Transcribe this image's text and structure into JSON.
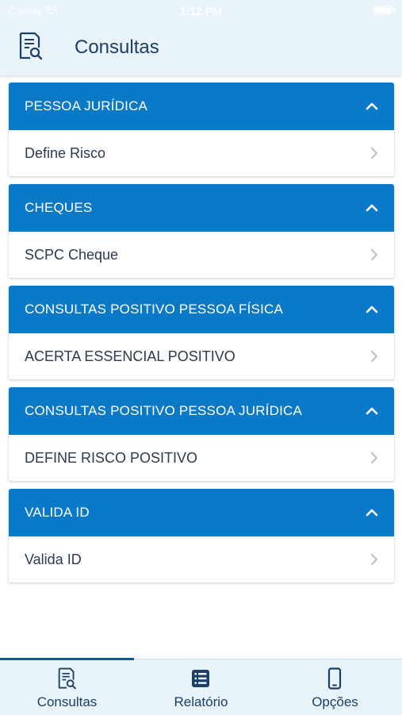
{
  "status_bar": {
    "carrier": "Carrier",
    "time": "1:12 PM"
  },
  "header": {
    "title": "Consultas",
    "icon": "document-search-icon"
  },
  "sections": [
    {
      "title": "PESSOA JURÍDICA",
      "item": "Define Risco"
    },
    {
      "title": "CHEQUES",
      "item": "SCPC Cheque"
    },
    {
      "title": "CONSULTAS POSITIVO PESSOA FÍSICA",
      "item": "ACERTA ESSENCIAL POSITIVO"
    },
    {
      "title": "CONSULTAS POSITIVO PESSOA JURÍDICA",
      "item": "DEFINE RISCO POSITIVO"
    },
    {
      "title": "VALIDA ID",
      "item": "Valida ID"
    }
  ],
  "tabs": [
    {
      "label": "Consultas",
      "icon": "document-search-icon",
      "active": true
    },
    {
      "label": "Relatório",
      "icon": "list-icon",
      "active": false
    },
    {
      "label": "Opções",
      "icon": "phone-icon",
      "active": false
    }
  ],
  "colors": {
    "accent": "#0a7ac8",
    "header_bg": "#e9f3fa",
    "title_text": "#1d3e66",
    "item_text": "#2b3a4c",
    "chevron": "#b8bec6"
  }
}
